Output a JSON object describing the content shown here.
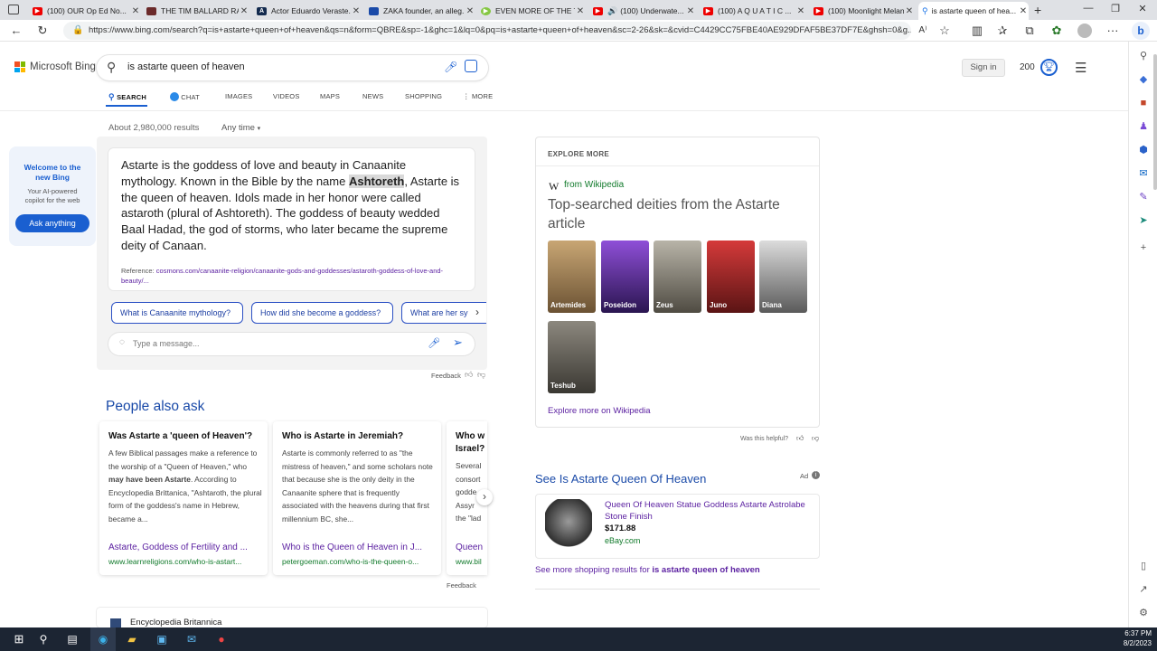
{
  "browser": {
    "tabs": [
      {
        "label": "(100) OUR Op Ed No...",
        "icon": "youtube-icon"
      },
      {
        "label": "THE TIM BALLARD RA...",
        "icon": "video-icon"
      },
      {
        "label": "Actor Eduardo Veraste...",
        "icon": "news-icon"
      },
      {
        "label": "ZAKA founder, an alleg...",
        "icon": "wiki-icon"
      },
      {
        "label": "EVEN MORE OF THE T...",
        "icon": "rumble-icon"
      },
      {
        "label": "(100) Underwate...",
        "icon": "youtube-icon"
      },
      {
        "label": "(100) A Q U A T I C ...",
        "icon": "youtube-icon"
      },
      {
        "label": "(100) Moonlight Melan...",
        "icon": "youtube-icon"
      },
      {
        "label": "is astarte queen of hea...",
        "icon": "bing-icon"
      }
    ],
    "url": "https://www.bing.com/search?q=is+astarte+queen+of+heaven&qs=n&form=QBRE&sp=-1&ghc=1&lq=0&pq=is+astarte+queen+of+heaven&sc=2-26&sk=&cvid=C4429CC75FBE40AE929DFAF5BE37DF7E&ghsh=0&g..."
  },
  "bing": {
    "logo": "Microsoft Bing",
    "query": "is astarte queen of heaven",
    "tabs": [
      "SEARCH",
      "CHAT",
      "IMAGES",
      "VIDEOS",
      "MAPS",
      "NEWS",
      "SHOPPING",
      "MORE"
    ],
    "signin": "Sign in",
    "points": "200",
    "result_count": "About 2,980,000 results",
    "time_filter": "Any time"
  },
  "promo": {
    "title": "Welcome to the new Bing",
    "subtitle": "Your AI-powered copilot for the web",
    "button": "Ask anything"
  },
  "answer": {
    "text_before": "Astarte is the goddess of love and beauty in Canaanite mythology. Known in the Bible by the name ",
    "highlight": "Ashtoreth",
    "text_after": ", Astarte is the queen of heaven. Idols made in her honor were called astaroth (plural of Ashtoreth). The goddess of beauty wedded Baal Hadad, the god of storms, who later became the supreme deity of Canaan.",
    "reference_label": "Reference: ",
    "reference_link": "cosmons.com/canaanite-religion/canaanite-gods-and-goddesses/astaroth-goddess-of-love-and-beauty/...",
    "suggestions": [
      "What is Canaanite mythology?",
      "How did she become a goddess?",
      "What are her sy"
    ],
    "message_placeholder": "Type a message...",
    "feedback": "Feedback"
  },
  "paa": {
    "heading": "People also ask",
    "items": [
      {
        "question": "Was Astarte a 'queen of Heaven'?",
        "body_before": "A few Biblical passages make a reference to the worship of a \"Queen of Heaven,\" who ",
        "body_bold": "may have been Astarte",
        "body_after": ". According to Encyclopedia Brittanica, \"Ashtaroth, the plural form of the goddess's name in Hebrew, became a...",
        "link": "Astarte, Goddess of Fertility and ...",
        "url": "www.learnreligions.com/who-is-astart..."
      },
      {
        "question": "Who is Astarte in Jeremiah?",
        "body_before": "Astarte is commonly referred to as \"the mistress of heaven,\" and some scholars note that because she is the only deity in the Canaanite sphere that is frequently associated with the heavens during that first millennium BC, she...",
        "body_bold": "",
        "body_after": "",
        "link": "Who is the Queen of Heaven in J...",
        "url": "petergoeman.com/who-is-the-queen-o..."
      },
      {
        "question": "Who w Israel?",
        "body_before": "Several consort godde Assyr the \"lad",
        "body_bold": "",
        "body_after": "",
        "link": "Queen",
        "url": "www.bil"
      }
    ],
    "feedback": "Feedback"
  },
  "explore": {
    "header": "EXPLORE MORE",
    "source": "from Wikipedia",
    "title": "Top-searched deities from the Astarte article",
    "deities": [
      "Artemides",
      "Poseidon",
      "Zeus",
      "Juno",
      "Diana",
      "Teshub"
    ],
    "more_link": "Explore more on Wikipedia",
    "helpful": "Was this helpful?"
  },
  "ad": {
    "heading": "See Is Astarte Queen Of Heaven",
    "badge": "Ad",
    "product_title": "Queen Of Heaven Statue Goddess Astarte Astrolabe Stone Finish",
    "price": "$171.88",
    "store": "eBay.com",
    "more_prefix": "See more shopping results for ",
    "more_query": "is astarte queen of heaven"
  },
  "next_result": "Encyclopedia Britannica",
  "taskbar": {
    "time": "6:37 PM",
    "date": "8/2/2023"
  }
}
